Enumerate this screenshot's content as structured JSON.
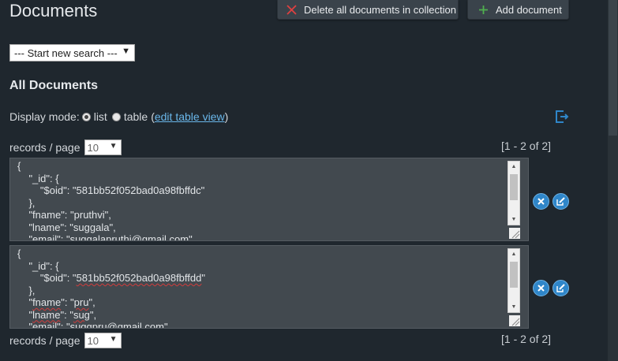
{
  "header": {
    "title": "Documents",
    "delete_all_label": "Delete all documents in collection",
    "add_document_label": "Add document"
  },
  "search": {
    "selected": "--- Start new search ---"
  },
  "section": {
    "title": "All Documents"
  },
  "display_mode": {
    "label": "Display mode:",
    "list_label": "list",
    "table_label": "table",
    "open_paren": "(",
    "edit_table_view": "edit table view",
    "close_paren": ")",
    "selected": "list"
  },
  "pagination": {
    "records_label": "records / page",
    "per_page": "10",
    "range": "[1 - 2 of 2]"
  },
  "documents": [
    {
      "lines": {
        "l1": "{",
        "l2": "    \"_id\": {",
        "l3": "        \"$oid\": \"581bb52f052bad0a98fbffdc\"",
        "l4": "    },",
        "l5": "    \"fname\": \"pruthvi\",",
        "l6": "    \"lname\": \"suggala\",",
        "l7": "    \"email\": \"suggalapruthi@gmail.com\""
      }
    },
    {
      "lines": {
        "l1": "{",
        "l2": "    \"_id\": {",
        "l3_pre": "        \"$oid\": \"",
        "l3_val": "581bb52f052bad0a98fbffdd",
        "l3_post": "\"",
        "l4": "    },",
        "l5_pre": "    \"",
        "l5_key": "fname",
        "l5_mid": "\": \"",
        "l5_val": "pru",
        "l5_post": "\",",
        "l6_pre": "    \"",
        "l6_key": "lname",
        "l6_mid": "\": \"",
        "l6_val": "sug",
        "l6_post": "\",",
        "l7": "    \"email\": \"suggpru@gmail.com\""
      }
    }
  ],
  "colors": {
    "accent": "#2f86c9",
    "link": "#6ab7ea",
    "background": "#1f272e"
  }
}
